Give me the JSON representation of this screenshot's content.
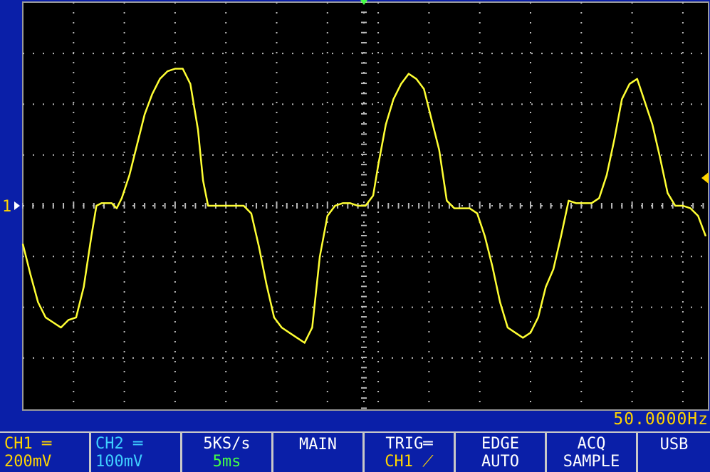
{
  "chart_data": {
    "type": "line",
    "title": "",
    "xlabel": "",
    "ylabel": "",
    "x_divisions": 13.5,
    "y_divisions": 8,
    "xlim": [
      0,
      13.5
    ],
    "ylim": [
      -4,
      4
    ],
    "grid": true,
    "series": [
      {
        "color": "#ffff33",
        "x": [
          0.0,
          0.15,
          0.3,
          0.45,
          0.6,
          0.75,
          0.9,
          1.05,
          1.2,
          1.35,
          1.45,
          1.55,
          1.65,
          1.75,
          1.85,
          1.95,
          2.1,
          2.25,
          2.4,
          2.55,
          2.7,
          2.85,
          3.0,
          3.15,
          3.3,
          3.45,
          3.55,
          3.65,
          3.75,
          3.9,
          4.05,
          4.2,
          4.35,
          4.5,
          4.65,
          4.8,
          4.95,
          5.1,
          5.25,
          5.4,
          5.55,
          5.7,
          5.85,
          6.0,
          6.15,
          6.3,
          6.45,
          6.6,
          6.75,
          6.9,
          7.0,
          7.15,
          7.3,
          7.45,
          7.6,
          7.75,
          7.9,
          8.05,
          8.2,
          8.35,
          8.5,
          8.65,
          8.8,
          8.95,
          9.1,
          9.25,
          9.4,
          9.55,
          9.7,
          9.85,
          10.0,
          10.15,
          10.3,
          10.45,
          10.6,
          10.75,
          10.9,
          11.05,
          11.2,
          11.35,
          11.5,
          11.65,
          11.8,
          11.95,
          12.1,
          12.25,
          12.4,
          12.55,
          12.7,
          12.85,
          13.0,
          13.15,
          13.3,
          13.45
        ],
        "y": [
          -0.75,
          -1.35,
          -1.9,
          -2.2,
          -2.3,
          -2.4,
          -2.25,
          -2.2,
          -1.6,
          -0.6,
          0.0,
          0.05,
          0.05,
          0.05,
          -0.05,
          0.15,
          0.6,
          1.2,
          1.8,
          2.2,
          2.5,
          2.65,
          2.7,
          2.7,
          2.4,
          1.5,
          0.5,
          0.0,
          0.0,
          0.0,
          0.0,
          0.0,
          0.0,
          -0.15,
          -0.8,
          -1.55,
          -2.2,
          -2.4,
          -2.5,
          -2.6,
          -2.7,
          -2.4,
          -1.0,
          -0.2,
          0.0,
          0.05,
          0.05,
          0.0,
          0.0,
          0.2,
          0.8,
          1.6,
          2.1,
          2.4,
          2.6,
          2.5,
          2.3,
          1.7,
          1.1,
          0.1,
          -0.05,
          -0.05,
          -0.05,
          -0.15,
          -0.6,
          -1.2,
          -1.9,
          -2.4,
          -2.5,
          -2.6,
          -2.5,
          -2.2,
          -1.6,
          -1.25,
          -0.6,
          0.1,
          0.05,
          0.05,
          0.05,
          0.15,
          0.6,
          1.3,
          2.1,
          2.4,
          2.5,
          2.05,
          1.6,
          0.95,
          0.25,
          0.0,
          0.0,
          -0.05,
          -0.2,
          -0.6
        ]
      }
    ],
    "markers": {
      "ch1_label": "1",
      "trigger_top_color": "#44ff44",
      "trigger_level_color": "#ffd400"
    }
  },
  "frequency": "50.0000Hz",
  "status": {
    "ch1": {
      "name": "CH1",
      "coupling_icon": "dc-coupling-icon",
      "scale": "200mV"
    },
    "ch2": {
      "name": "CH2",
      "coupling_icon": "dc-coupling-icon",
      "scale": "100mV"
    },
    "rate": {
      "top": "5KS/s",
      "bottom": "5ms"
    },
    "main": {
      "label": "MAIN"
    },
    "trig": {
      "top": "TRIG",
      "coupling_icon": "dc-coupling-icon",
      "source": "CH1",
      "slope_icon": "rising-edge-icon"
    },
    "edge": {
      "top": "EDGE",
      "bottom": "AUTO"
    },
    "acq": {
      "top": "ACQ",
      "bottom": "SAMPLE"
    },
    "usb": {
      "label": "USB"
    }
  },
  "colors": {
    "background": "#0a1fa8",
    "screen": "#000000",
    "trace": "#ffff33",
    "ch1": "#ffd400",
    "ch2": "#3fd0ff",
    "accent_green": "#44ff44",
    "grid": "#bbbbbb"
  }
}
